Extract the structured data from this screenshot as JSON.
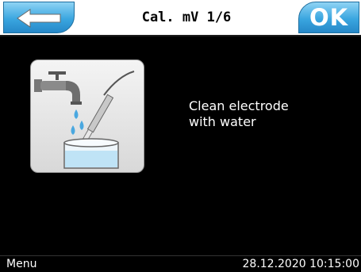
{
  "header": {
    "title": "Cal. mV 1/6",
    "ok_label": "OK",
    "back_icon": "arrow-left-icon",
    "button_color": "#3aa6e0"
  },
  "content": {
    "illustration_icon": "rinse-electrode-under-tap-icon",
    "instruction_line1": "Clean electrode",
    "instruction_line2": "with water"
  },
  "footer": {
    "menu_label": "Menu",
    "datetime": "28.12.2020 10:15:00"
  }
}
